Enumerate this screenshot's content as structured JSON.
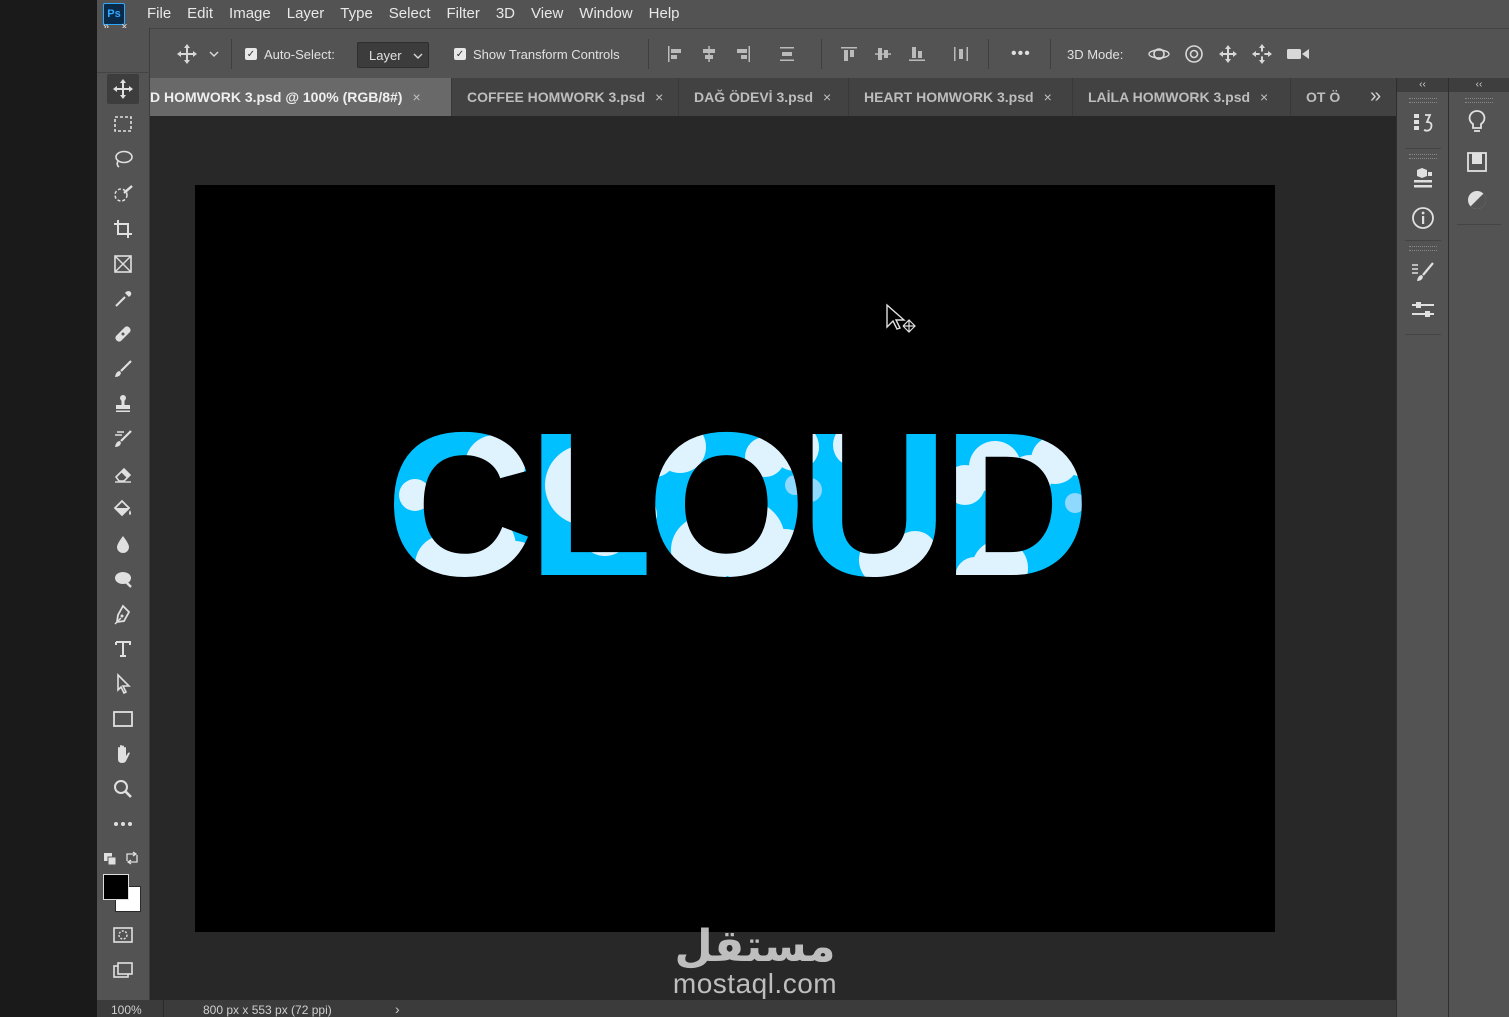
{
  "app": {
    "logo_text": "Ps",
    "menu": [
      "File",
      "Edit",
      "Image",
      "Layer",
      "Type",
      "Select",
      "Filter",
      "3D",
      "View",
      "Window",
      "Help"
    ],
    "accent_color": "#31a8ff"
  },
  "options_bar": {
    "auto_select_label": "Auto-Select:",
    "auto_select_checked": true,
    "target_value": "Layer",
    "show_transform_label": "Show Transform Controls",
    "show_transform_checked": true,
    "more_label": "•••",
    "mode_3d_label": "3D Mode:"
  },
  "toolbar": {
    "collapse_label": "»",
    "close_label": "×",
    "tools": [
      "move-tool",
      "marquee-tool",
      "lasso-tool",
      "quick-selection-tool",
      "crop-tool",
      "frame-tool",
      "eyedropper-tool",
      "healing-brush-tool",
      "brush-tool",
      "clone-stamp-tool",
      "history-brush-tool",
      "eraser-tool",
      "paint-bucket-tool",
      "blur-tool",
      "dodge-tool",
      "pen-tool",
      "type-tool",
      "path-selection-tool",
      "rectangle-tool",
      "hand-tool",
      "zoom-tool",
      "edit-toolbar-icon"
    ],
    "foreground_color": "#000000",
    "background_color": "#ffffff"
  },
  "tabs": [
    {
      "label": "D HOMWORK 3.psd @ 100% (RGB/8#)",
      "active": true
    },
    {
      "label": "COFFEE HOMWORK 3.psd",
      "active": false
    },
    {
      "label": "DAĞ ÖDEVİ 3.psd",
      "active": false
    },
    {
      "label": "HEART HOMWORK 3.psd",
      "active": false
    },
    {
      "label": "LAİLA HOMWORK 3.psd",
      "active": false
    },
    {
      "label": "OT Ö",
      "active": false
    }
  ],
  "tab_close_glyph": "×",
  "tab_overflow_label": "»",
  "canvas": {
    "text": "CLOUD",
    "background_color": "#000000",
    "text_color": "#00c0ff"
  },
  "status": {
    "zoom": "100%",
    "doc_info": "800 px x 553 px (72 ppi)",
    "arrow": "›"
  },
  "right_panels": {
    "collapse_glyph": "‹‹",
    "group_a_icons": [
      "history-icon",
      "3d-layers-icon",
      "info-icon",
      "brush-settings-icon",
      "properties-icon"
    ],
    "group_b_icons": [
      "learn-icon",
      "libraries-icon",
      "adjustments-icon"
    ]
  },
  "watermark": {
    "arabic": "مستقل",
    "latin": "mostaql.com"
  }
}
